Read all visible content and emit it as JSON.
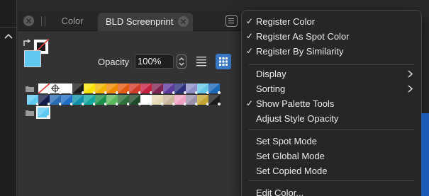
{
  "tabs": [
    {
      "label": "Color",
      "active": false
    },
    {
      "label": "BLD Screenprint",
      "active": true
    }
  ],
  "controls": {
    "opacity_label": "Opacity",
    "opacity_value": "100%"
  },
  "colors": {
    "fill": "#5ec8f1",
    "accent": "#3b78c4",
    "menu_bg": "#262626",
    "panel_bg": "#333333"
  },
  "palette": {
    "row1": [
      "none",
      "registration",
      "#ffffff",
      "#1c1c1c",
      "#f6e400",
      "#f2b500",
      "#f08a00",
      "#e35a12",
      "#d23a2a",
      "#c21f3e",
      "#7e2453",
      "#5b3a9c",
      "#2c2f7a",
      "#8e8dc6",
      "#68c8e8",
      "#1a67b5"
    ],
    "row2": [
      "#5ec8f1",
      "#121c4a",
      "#2b6cb3",
      "#1e6dc5",
      "#0f8fa8",
      "#13a89e",
      "#1d8f4a",
      "#5cb85c",
      "#2e6f3a",
      "#1f4a2a",
      "#ffffff",
      "#e4d9b5",
      "#c9b49a",
      "#f0a0c0",
      "#9a8fa8",
      "#c3a532",
      "#1c1c1c"
    ],
    "row3": [
      "#5ec8f1"
    ]
  },
  "menu": {
    "items": [
      {
        "label": "Register Color",
        "checked": true
      },
      {
        "label": "Register As Spot Color",
        "checked": true
      },
      {
        "label": "Register By Similarity",
        "checked": true
      },
      {
        "label": "Display",
        "submenu": true
      },
      {
        "label": "Sorting",
        "submenu": true
      },
      {
        "label": "Show Palette Tools",
        "checked": true
      },
      {
        "label": "Adjust Style Opacity"
      },
      {
        "label": "Set Spot Mode"
      },
      {
        "label": "Set Global Mode"
      },
      {
        "label": "Set Copied Mode"
      },
      {
        "label": "Edit Color..."
      }
    ],
    "check_glyph": "✓"
  }
}
